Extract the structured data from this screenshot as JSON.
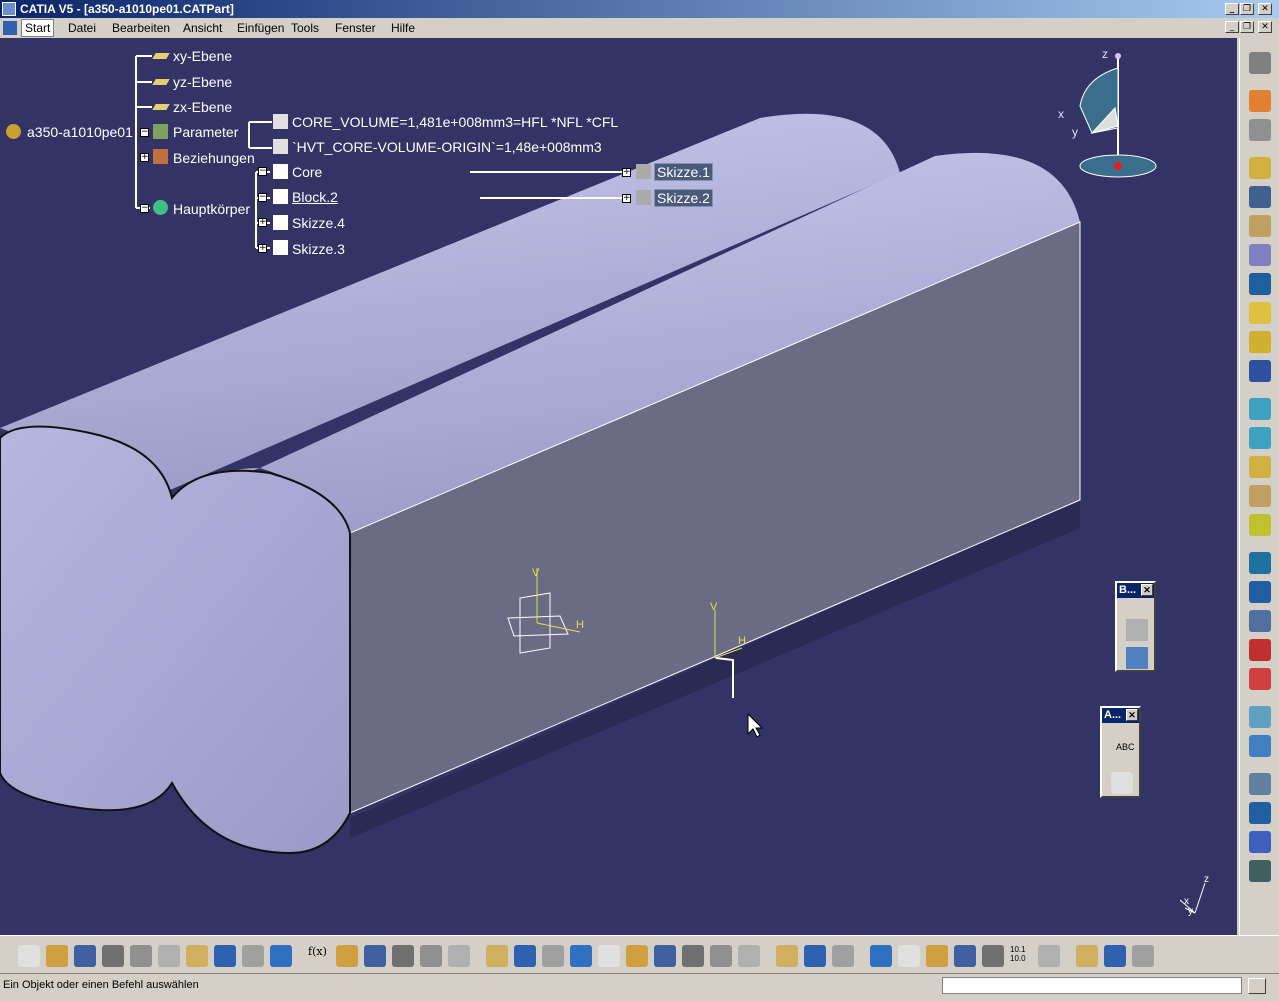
{
  "window": {
    "title": "CATIA V5 - [a350-a1010pe01.CATPart]",
    "controls": {
      "minimize": "_",
      "restore": "❐",
      "close": "✕"
    }
  },
  "menu": {
    "items": [
      {
        "label": "Start"
      },
      {
        "label": "Datei"
      },
      {
        "label": "Bearbeiten"
      },
      {
        "label": "Ansicht"
      },
      {
        "label": "Einfügen"
      },
      {
        "label": "Tools"
      },
      {
        "label": "Fenster"
      },
      {
        "label": "Hilfe"
      }
    ]
  },
  "tree": {
    "root": "a350-a1010pe01",
    "planes": [
      "xy-Ebene",
      "yz-Ebene",
      "zx-Ebene"
    ],
    "parameter": {
      "label": "Parameter",
      "items": [
        "CORE_VOLUME=1,481e+008mm3=HFL *NFL *CFL",
        "`HVT_CORE-VOLUME-ORIGIN`=1,48e+008mm3"
      ]
    },
    "relations": "Beziehungen",
    "body": {
      "label": "Hauptkörper",
      "items": [
        "Core",
        "Block.2",
        "Skizze.4",
        "Skizze.3"
      ],
      "core_child": "Skizze.1",
      "block_child": "Skizze.2"
    }
  },
  "compass": {
    "x": "x",
    "y": "y",
    "z": "z"
  },
  "sketch_axes": {
    "v": "V",
    "h": "H"
  },
  "corner_axes": {
    "x": "x",
    "y": "y",
    "z": "z"
  },
  "panels": [
    {
      "title": "B...",
      "close": "✕"
    },
    {
      "title": "A...",
      "close": "✕",
      "text_icon": "ABC"
    }
  ],
  "right_toolbar": {
    "icons": [
      "gear-icon",
      "select-icon",
      "sketcher-icon",
      "pad-icon",
      "pocket-icon",
      "shaft-icon",
      "groove-icon",
      "hole-icon",
      "rib-icon",
      "slot-icon",
      "stiffener-icon",
      "multi-section-icon",
      "removed-multi-section-icon",
      "fillet-icon",
      "chamfer-icon",
      "draft-icon",
      "shell-icon",
      "thickness-icon",
      "thread-icon",
      "remove-face-icon",
      "split-icon",
      "thick-surface-icon",
      "close-surface-icon",
      "translation-icon",
      "mirror-icon",
      "pattern-icon",
      "scaling-icon"
    ]
  },
  "bottom_toolbar": {
    "icons": [
      "new-icon",
      "open-icon",
      "save-icon",
      "print-icon",
      "cut-icon",
      "copy-icon",
      "paste-icon",
      "undo-icon",
      "redo-icon",
      "help-icon",
      "formula-icon",
      "comment-icon",
      "knowledge-icon",
      "table-icon",
      "lock-icon",
      "measure-icon",
      "fly-icon",
      "fit-all-icon",
      "pan-icon",
      "rotate-icon",
      "zoom-in-icon",
      "zoom-out-icon",
      "normal-view-icon",
      "view-modes-icon",
      "render-style-icon",
      "hide-show-icon",
      "swap-icon",
      "update-icon",
      "analysis-icon",
      "apply-material-icon",
      "sketch-analysis-icon",
      "constraint-icon",
      "axis-system-icon",
      "measure-between-icon",
      "parameters-table-icon",
      "list-icon",
      "plane-icon",
      "edit-icon",
      "catia-logo"
    ]
  },
  "status": {
    "message": "Ein Objekt oder einen Befehl auswählen",
    "input_value": ""
  },
  "text_marks": {
    "formula": "f(x)",
    "units": "10.1\n10.0"
  },
  "colors": {
    "viewport_bg": "#333366",
    "solid_top": "#b8b8e0",
    "solid_face": "#6a6a85",
    "tree_text": "#ffffff"
  }
}
